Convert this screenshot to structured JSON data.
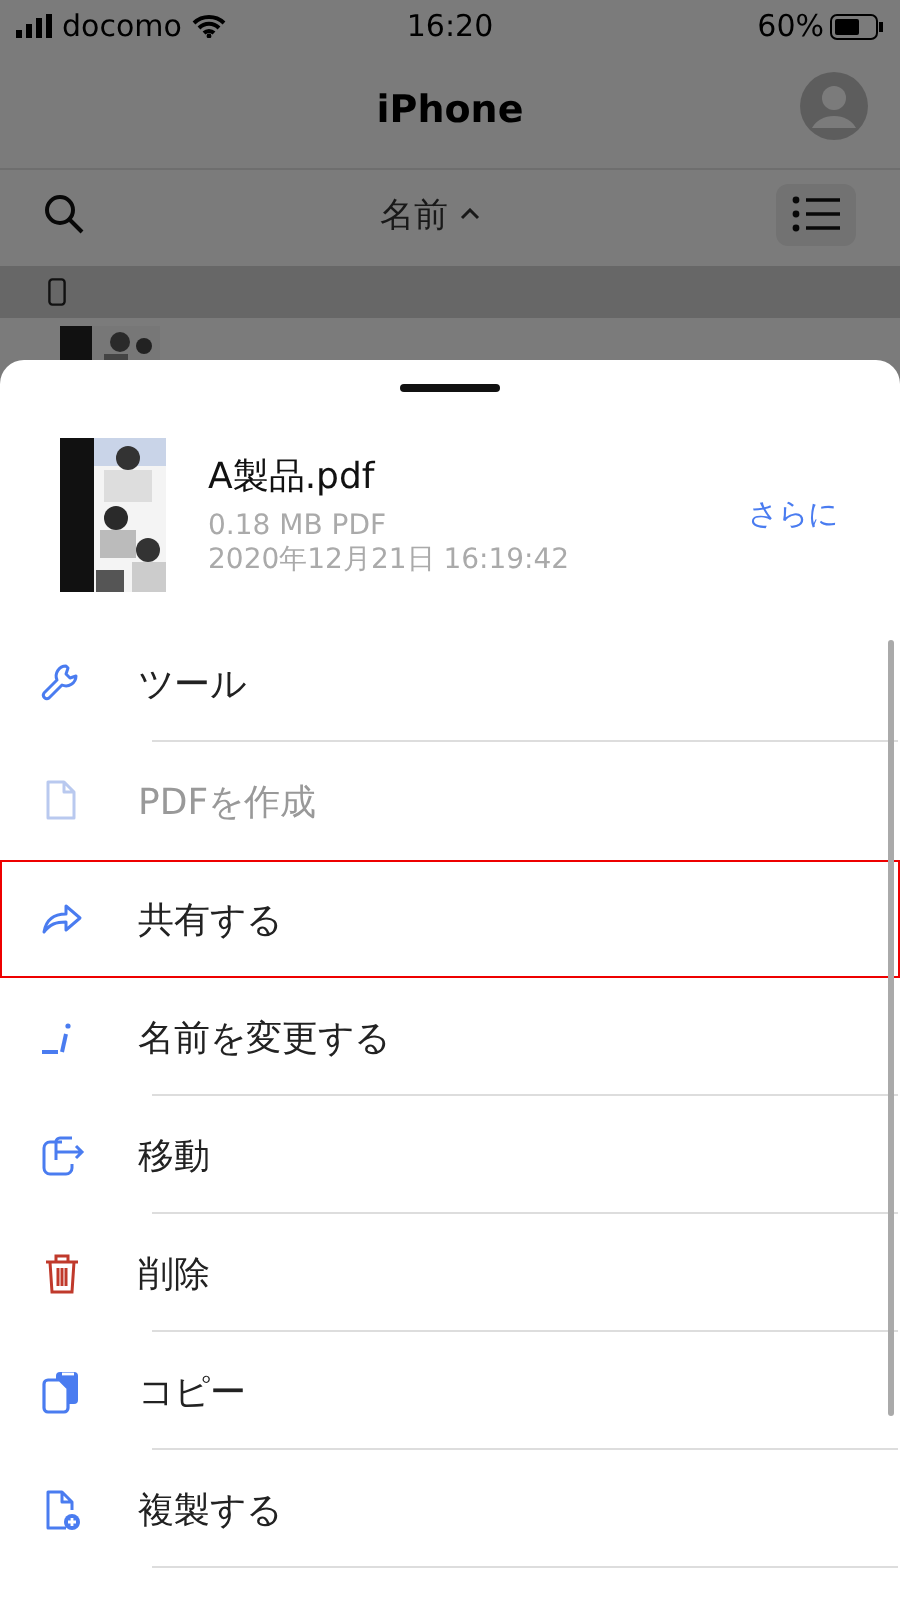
{
  "status_bar": {
    "carrier": "docomo",
    "time": "16:20",
    "battery": "60%"
  },
  "header": {
    "title": "iPhone"
  },
  "toolbar": {
    "sort_label": "名前"
  },
  "sheet": {
    "file": {
      "name": "A製品.pdf",
      "size": "0.18 MB PDF",
      "date": "2020年12月21日 16:19:42"
    },
    "more_link": "さらに",
    "actions": [
      {
        "kind": "tools",
        "label": "ツール",
        "disabled": false,
        "highlighted": false
      },
      {
        "kind": "create-pdf",
        "label": "PDFを作成",
        "disabled": true,
        "highlighted": false
      },
      {
        "kind": "share",
        "label": "共有する",
        "disabled": false,
        "highlighted": true
      },
      {
        "kind": "rename",
        "label": "名前を変更する",
        "disabled": false,
        "highlighted": false
      },
      {
        "kind": "move",
        "label": "移動",
        "disabled": false,
        "highlighted": false
      },
      {
        "kind": "delete",
        "label": "削除",
        "disabled": false,
        "highlighted": false
      },
      {
        "kind": "copy",
        "label": "コピー",
        "disabled": false,
        "highlighted": false
      },
      {
        "kind": "duplicate",
        "label": "複製する",
        "disabled": false,
        "highlighted": false
      }
    ]
  }
}
